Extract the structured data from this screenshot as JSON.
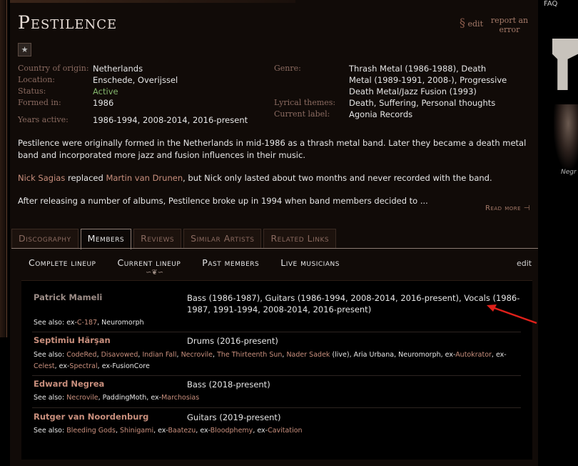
{
  "band": {
    "name": "Pestilence",
    "edit_label": "edit",
    "report_label": "report an error"
  },
  "info": {
    "left": [
      {
        "label": "Country of origin:",
        "value": "Netherlands",
        "link": true
      },
      {
        "label": "Location:",
        "value": "Enschede, Overijssel"
      },
      {
        "label": "Status:",
        "value": "Active",
        "status": true
      },
      {
        "label": "Formed in:",
        "value": "1986"
      }
    ],
    "years_label": "Years active:",
    "years_value": "1986-1994, 2008-2014, 2016-present",
    "right": [
      {
        "label": "Genre:",
        "value": "Thrash Metal (1986-1988), Death Metal (1989-1991, 2008-), Progressive Death Metal/Jazz Fusion (1993)"
      },
      {
        "label": "Lyrical themes:",
        "value": "Death, Suffering, Personal thoughts"
      },
      {
        "label": "Current label:",
        "value": "Agonia Records",
        "link": true
      }
    ]
  },
  "description": {
    "p1": "Pestilence were originally formed in the Netherlands in mid-1986 as a thrash metal band. Later they became a death metal band and incorporated more jazz and fusion influences in their music.",
    "p2_link1": "Nick Sagias",
    "p2_text1": " replaced ",
    "p2_link2": "Martin van Drunen",
    "p2_text2": ", but Nick only lasted about two months and never recorded with the band.",
    "p3": "After releasing a number of albums, Pestilence broke up in 1994 when band members decided to ...",
    "read_more": "Read more"
  },
  "tabs": [
    "Discography",
    "Members",
    "Reviews",
    "Similar Artists",
    "Related Links"
  ],
  "subtabs": [
    "Complete lineup",
    "Current lineup",
    "Past members",
    "Live musicians"
  ],
  "members_edit": "edit",
  "see_also_label": "See also:",
  "members": [
    {
      "name": "Patrick Mameli",
      "role": "Bass (1986-1987), Guitars (1986-1994, 2008-2014, 2016-present), Vocals (1986-1987, 1991-1994, 2008-2014, 2016-present)",
      "see_also": [
        {
          "text": "ex-",
          "link": false
        },
        {
          "text": "C-187",
          "link": true
        },
        {
          "text": ", Neuromorph",
          "link": false
        }
      ]
    },
    {
      "name": "Septimiu Hărşan",
      "role": "Drums (2016-present)",
      "see_also": [
        {
          "text": "CodeRed",
          "link": true
        },
        {
          "text": ", ",
          "link": false
        },
        {
          "text": "Disavowed",
          "link": true
        },
        {
          "text": ", ",
          "link": false
        },
        {
          "text": "Indian Fall",
          "link": true
        },
        {
          "text": ", ",
          "link": false
        },
        {
          "text": "Necrovile",
          "link": true
        },
        {
          "text": ", ",
          "link": false
        },
        {
          "text": "The Thirteenth Sun",
          "link": true
        },
        {
          "text": ", ",
          "link": false
        },
        {
          "text": "Nader Sadek",
          "link": true
        },
        {
          "text": " (live), Aria Urbana, Neuromorph, ex-",
          "link": false
        },
        {
          "text": "Autokrator",
          "link": true
        },
        {
          "text": ", ex-",
          "link": false
        },
        {
          "text": "Celest",
          "link": true
        },
        {
          "text": ", ex-",
          "link": false
        },
        {
          "text": "Spectral",
          "link": true
        },
        {
          "text": ", ex-FusionCore",
          "link": false
        }
      ]
    },
    {
      "name": "Edward Negrea",
      "role": "Bass (2018-present)",
      "see_also": [
        {
          "text": "Necrovile",
          "link": true
        },
        {
          "text": ", PaddingMoth, ex-",
          "link": false
        },
        {
          "text": "Marchosias",
          "link": true
        }
      ]
    },
    {
      "name": "Rutger van Noordenburg",
      "role": "Guitars (2019-present)",
      "see_also": [
        {
          "text": "Bleeding Gods",
          "link": true
        },
        {
          "text": ", ",
          "link": false
        },
        {
          "text": "Shinigami",
          "link": true
        },
        {
          "text": ", ex-",
          "link": false
        },
        {
          "text": "Baatezu",
          "link": true
        },
        {
          "text": ", ex-",
          "link": false
        },
        {
          "text": "Bloodphemy",
          "link": true
        },
        {
          "text": ", ex-",
          "link": false
        },
        {
          "text": "Cavitation",
          "link": true
        }
      ]
    }
  ],
  "right_sidebar": {
    "top_text": "FAQ",
    "caption": "Negr"
  },
  "colors": {
    "link": "#c98f7d",
    "status_active": "#84b66c",
    "arrow": "#e0201a"
  }
}
